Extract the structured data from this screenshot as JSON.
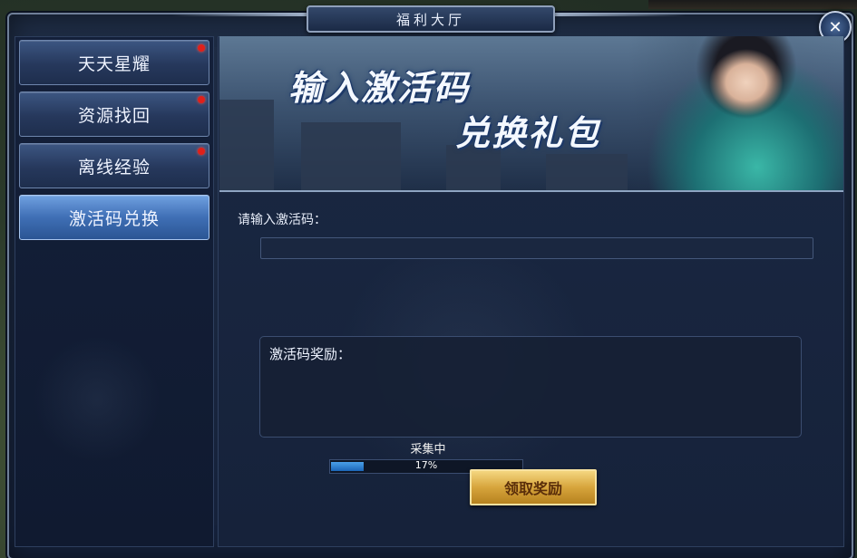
{
  "window": {
    "title": "福利大厅",
    "close_glyph": "✕"
  },
  "sidebar": {
    "items": [
      {
        "label": "天天星耀",
        "badge": true
      },
      {
        "label": "资源找回",
        "badge": true
      },
      {
        "label": "离线经验",
        "badge": true
      },
      {
        "label": "激活码兑换",
        "badge": false,
        "active": true
      }
    ]
  },
  "banner": {
    "line1": "输入激活码",
    "line2": "兑换礼包"
  },
  "form": {
    "input_label": "请输入激活码：",
    "input_value": "",
    "reward_label": "激活码奖励："
  },
  "progress": {
    "label": "采集中",
    "percent_text": "17%",
    "fraction": 0.17
  },
  "claim_button": {
    "label": "领取奖励"
  },
  "colors": {
    "active_tab": "#3f6fb5",
    "badge": "#e0201a",
    "claim_button": "#d7a53c",
    "progress": "#1c66b8"
  },
  "icons": {
    "close": "close-icon",
    "badge": "red-dot-badge"
  }
}
